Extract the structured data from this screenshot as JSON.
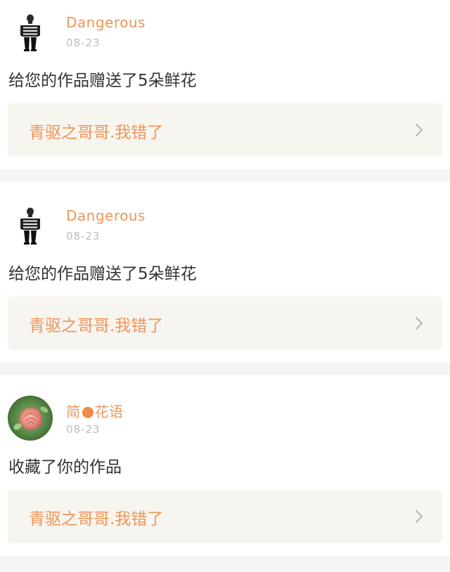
{
  "notifications": [
    {
      "username_prefix": "Dangerous",
      "username_suffix": "",
      "has_dot": false,
      "avatar": "striped-figure-avatar",
      "date": "08-23",
      "message": "给您的作品赠送了5朵鲜花",
      "work_title": "青驱之哥哥.我错了",
      "chevron": "chevron-right-icon"
    },
    {
      "username_prefix": "Dangerous",
      "username_suffix": "",
      "has_dot": false,
      "avatar": "striped-figure-avatar",
      "date": "08-23",
      "message": "给您的作品赠送了5朵鲜花",
      "work_title": "青驱之哥哥.我错了",
      "chevron": "chevron-right-icon"
    },
    {
      "username_prefix": "简",
      "username_suffix": "花语",
      "has_dot": true,
      "avatar": "rose-avatar",
      "date": "08-23",
      "message": "收藏了你的作品",
      "work_title": "青驱之哥哥.我错了",
      "chevron": "chevron-right-icon"
    }
  ],
  "colors": {
    "accent": "#f0955a",
    "date": "#bdbdbd",
    "message": "#333333",
    "work_box_bg": "#f6f5ef",
    "divider_bg": "#f5f5f5",
    "dot": "#f28a4a"
  }
}
